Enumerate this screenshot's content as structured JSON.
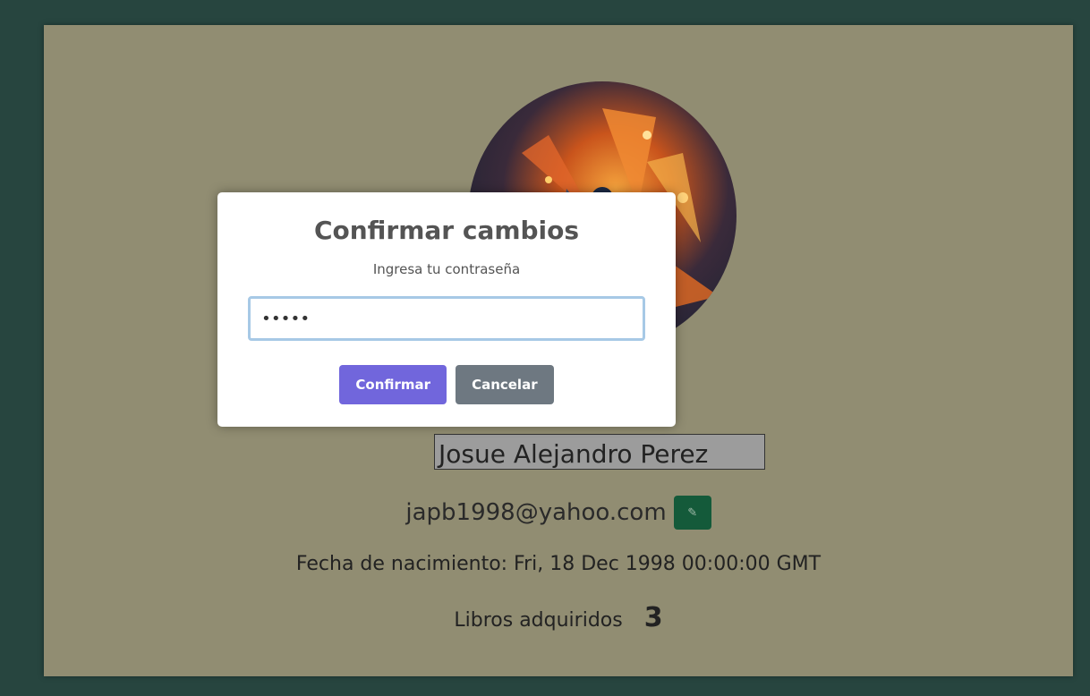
{
  "profile": {
    "name": "Josue Alejandro Perez",
    "email": "japb1998@yahoo.com",
    "edit_icon": "✎",
    "birth_label": "Fecha de nacimiento: Fri, 18 Dec 1998 00:00:00 GMT",
    "books_label": "Libros adquiridos",
    "books_count": "3"
  },
  "modal": {
    "title": "Confirmar cambios",
    "subtitle": "Ingresa tu contraseña",
    "password_value": "•••••",
    "confirm_label": "Confirmar",
    "cancel_label": "Cancelar"
  },
  "colors": {
    "page_bg": "#27453f",
    "card_bg": "#918d72",
    "confirm_btn": "#7166dc",
    "cancel_btn": "#6e7881",
    "edit_btn": "#145a3a"
  }
}
